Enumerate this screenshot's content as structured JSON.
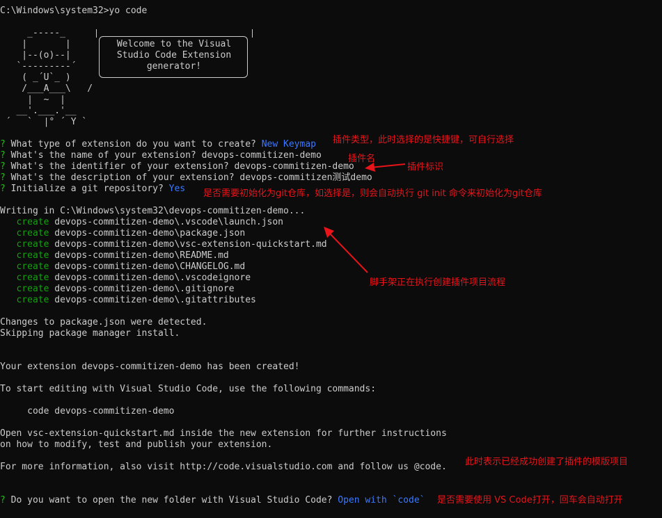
{
  "prompt_line": "C:\\Windows\\system32>yo code",
  "yeoman_ascii": {
    "hat_line": "     _-----_",
    "l1": "    |       |",
    "l2": "    |--(o)--|",
    "l3": "   `---------´",
    "l4": "    ( _´U`_ )",
    "l5": "    /___A___\\   /",
    "l6": "     |  ~  |",
    "l7": "   __'.___.'__",
    "l8": " ´   `  |° ´ Y `"
  },
  "bubble_text": "Welcome to the Visual\nStudio Code Extension\ngenerator!",
  "questions": [
    {
      "mark": "?",
      "text": " What type of extension do you want to create? ",
      "answer": "New Keymap"
    },
    {
      "mark": "?",
      "text": " What's the name of your extension? devops-commitizen-demo",
      "answer": ""
    },
    {
      "mark": "?",
      "text": " What's the identifier of your extension? devops-commitizen-demo",
      "answer": ""
    },
    {
      "mark": "?",
      "text": " What's the description of your extension? devops-commitizen测试demo",
      "answer": ""
    },
    {
      "mark": "?",
      "text": " Initialize a git repository? ",
      "answer": "Yes"
    }
  ],
  "writing_line": "Writing in C:\\Windows\\system32\\devops-commitizen-demo...",
  "create_keyword": "create",
  "created_files": [
    "devops-commitizen-demo\\.vscode\\launch.json",
    "devops-commitizen-demo\\package.json",
    "devops-commitizen-demo\\vsc-extension-quickstart.md",
    "devops-commitizen-demo\\README.md",
    "devops-commitizen-demo\\CHANGELOG.md",
    "devops-commitizen-demo\\.vscodeignore",
    "devops-commitizen-demo\\.gitignore",
    "devops-commitizen-demo\\.gitattributes"
  ],
  "changes_line": "Changes to package.json were detected.",
  "skipping_line": "Skipping package manager install.",
  "created_line": "Your extension devops-commitizen-demo has been created!",
  "start_editing_line": "To start editing with Visual Studio Code, use the following commands:",
  "code_command": "     code devops-commitizen-demo",
  "open_line_1": "Open vsc-extension-quickstart.md inside the new extension for further instructions",
  "open_line_2": "on how to modify, test and publish your extension.",
  "more_info_line": "For more information, also visit http://code.visualstudio.com and follow us @code.",
  "final_question": {
    "mark": "?",
    "text": " Do you want to open the new folder with Visual Studio Code? ",
    "answer": "Open with `code`"
  },
  "annotations": {
    "type_note": "插件类型，此时选择的是快捷键，可自行选择",
    "name_note": "插件名",
    "id_note": "插件标识",
    "git_note": "是否需要初始化为git仓库，如选择是，则会自动执行 git init  命令来初始化为git仓库",
    "scaffold_note": "脚手架正在执行创建插件项目流程",
    "done_note": "此时表示已经成功创建了插件的模版项目",
    "open_note": "是否需要使用 VS Code打开，回车会自动打开"
  },
  "colors": {
    "background": "#0c0c0c",
    "foreground": "#cccccc",
    "question_mark": "#16c60c",
    "answer": "#3b78ff",
    "create": "#13a10e",
    "annotation": "#e8141a"
  }
}
